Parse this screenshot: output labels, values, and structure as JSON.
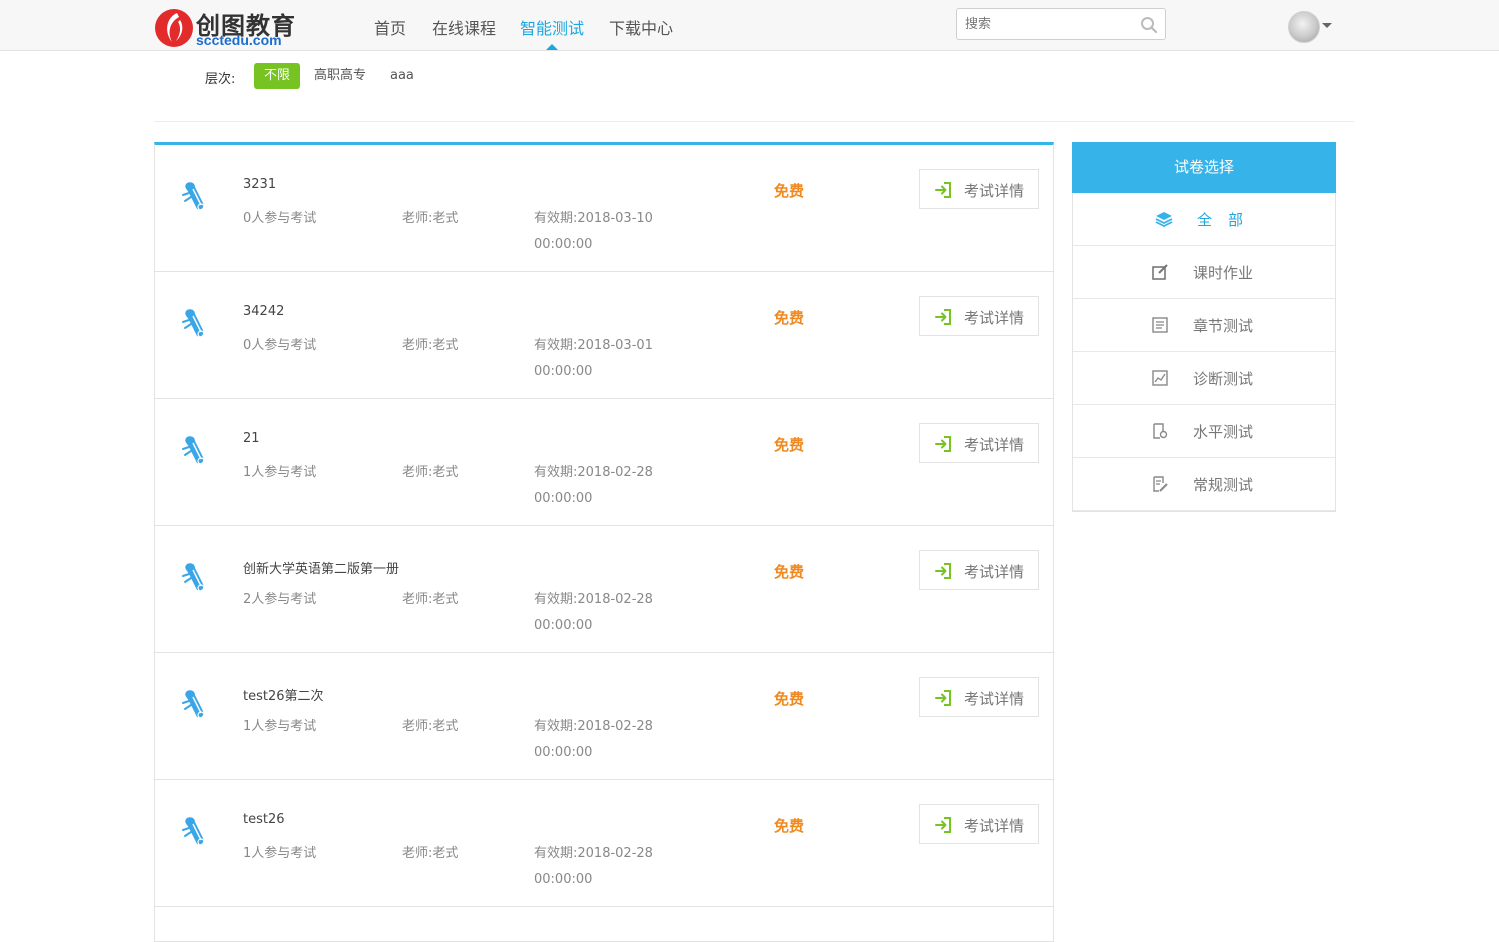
{
  "header": {
    "logo_cn": "创图教育",
    "logo_en": "scctedu.com",
    "nav": [
      "首页",
      "在线课程",
      "智能测试",
      "下载中心"
    ],
    "nav_active_index": 2,
    "search_placeholder": "搜索"
  },
  "filter": {
    "label": "层次:",
    "options": [
      "不限",
      "高职高专",
      "aaa"
    ],
    "active_index": 0,
    "accent_color": "#77c322"
  },
  "exams": [
    {
      "title": "3231",
      "participants": "0人参与考试",
      "teacher": "老师:老式",
      "valid": "有效期:2018-03-10",
      "valid_time": "00:00:00",
      "price": "免费",
      "action": "考试详情"
    },
    {
      "title": "34242",
      "participants": "0人参与考试",
      "teacher": "老师:老式",
      "valid": "有效期:2018-03-01",
      "valid_time": "00:00:00",
      "price": "免费",
      "action": "考试详情"
    },
    {
      "title": "21",
      "participants": "1人参与考试",
      "teacher": "老师:老式",
      "valid": "有效期:2018-02-28",
      "valid_time": "00:00:00",
      "price": "免费",
      "action": "考试详情"
    },
    {
      "title": "创新大学英语第二版第一册",
      "participants": "2人参与考试",
      "teacher": "老师:老式",
      "valid": "有效期:2018-02-28",
      "valid_time": "00:00:00",
      "price": "免费",
      "action": "考试详情"
    },
    {
      "title": "test26第二次",
      "participants": "1人参与考试",
      "teacher": "老师:老式",
      "valid": "有效期:2018-02-28",
      "valid_time": "00:00:00",
      "price": "免费",
      "action": "考试详情"
    },
    {
      "title": "test26",
      "participants": "1人参与考试",
      "teacher": "老师:老式",
      "valid": "有效期:2018-02-28",
      "valid_time": "00:00:00",
      "price": "免费",
      "action": "考试详情"
    }
  ],
  "side_panel": {
    "title": "试卷选择",
    "items": [
      {
        "label": "全部",
        "icon": "layers-icon",
        "active": true
      },
      {
        "label": "课时作业",
        "icon": "edit-icon",
        "active": false
      },
      {
        "label": "章节测试",
        "icon": "list-icon",
        "active": false
      },
      {
        "label": "诊断测试",
        "icon": "chart-icon",
        "active": false
      },
      {
        "label": "水平测试",
        "icon": "doc-search-icon",
        "active": false
      },
      {
        "label": "常规测试",
        "icon": "doc-edit-icon",
        "active": false
      }
    ]
  },
  "colors": {
    "brand_blue": "#36b4ea",
    "nav_active": "#1da7e0",
    "price": "#f0891f",
    "action_arrow": "#77c322",
    "logo_red": "#e22b2b"
  }
}
